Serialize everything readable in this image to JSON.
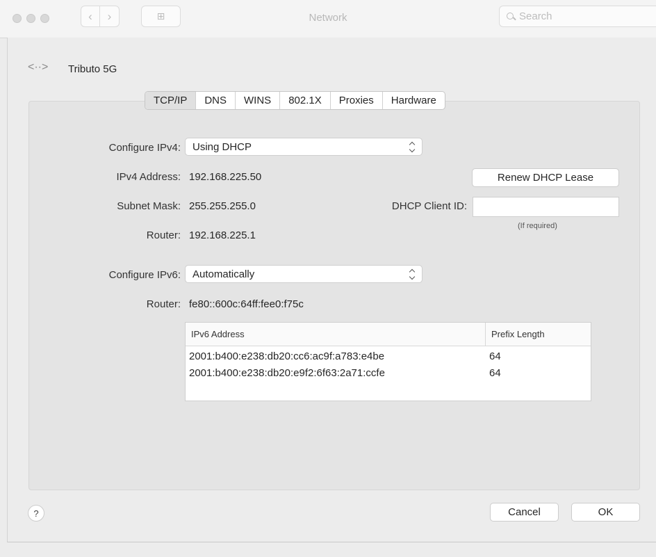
{
  "window": {
    "title": "Network",
    "search_placeholder": "Search",
    "grid_icon": "⊞"
  },
  "interface": {
    "icon": "<··>",
    "name": "Tributo 5G"
  },
  "tabs": [
    {
      "label": "TCP/IP",
      "active": true
    },
    {
      "label": "DNS"
    },
    {
      "label": "WINS"
    },
    {
      "label": "802.1X"
    },
    {
      "label": "Proxies"
    },
    {
      "label": "Hardware"
    }
  ],
  "ipv4": {
    "configure_label": "Configure IPv4:",
    "configure_value": "Using DHCP",
    "address_label": "IPv4 Address:",
    "address_value": "192.168.225.50",
    "subnet_label": "Subnet Mask:",
    "subnet_value": "255.255.255.0",
    "router_label": "Router:",
    "router_value": "192.168.225.1",
    "renew_button": "Renew DHCP Lease",
    "client_id_label": "DHCP Client ID:",
    "client_id_value": "",
    "client_id_hint": "(If required)"
  },
  "ipv6": {
    "configure_label": "Configure IPv6:",
    "configure_value": "Automatically",
    "router_label": "Router:",
    "router_value": "fe80::600c:64ff:fee0:f75c",
    "table": {
      "headers": [
        "IPv6 Address",
        "Prefix Length"
      ],
      "rows": [
        [
          "2001:b400:e238:db20:cc6:ac9f:a783:e4be",
          "64"
        ],
        [
          "2001:b400:e238:db20:e9f2:6f63:2a71:ccfe",
          "64"
        ]
      ]
    }
  },
  "footer": {
    "help": "?",
    "cancel": "Cancel",
    "ok": "OK"
  }
}
